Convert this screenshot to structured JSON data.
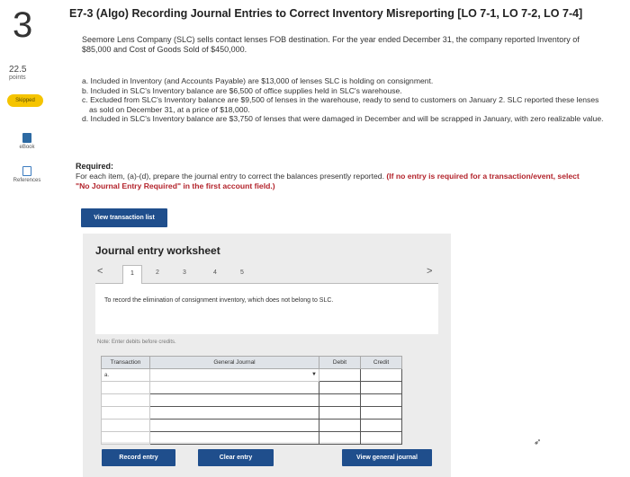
{
  "question": {
    "number": "3",
    "points_value": "22.5",
    "points_label": "points",
    "status_badge": "Skipped"
  },
  "sidebar": {
    "ebook_label": "eBook",
    "references_label": "References"
  },
  "title": "E7-3 (Algo) Recording Journal Entries to Correct Inventory Misreporting [LO 7-1, LO 7-2, LO 7-4]",
  "intro": "Seemore Lens Company (SLC) sells contact lenses FOB destination. For the year ended December 31, the company reported Inventory of $85,000 and Cost of Goods Sold of $450,000.",
  "items": [
    "a. Included in Inventory (and Accounts Payable) are $13,000 of lenses SLC is holding on consignment.",
    "b. Included in SLC's Inventory balance are $6,500 of office supplies held in SLC's warehouse.",
    "c. Excluded from SLC's Inventory balance are $9,500 of lenses in the warehouse, ready to send to customers on January 2. SLC reported these lenses as sold on December 31, at a price of $18,000.",
    "d. Included in SLC's Inventory balance are $3,750 of lenses that were damaged in December and will be scrapped in January, with zero realizable value."
  ],
  "required": {
    "heading": "Required:",
    "body": "For each item, (a)-(d), prepare the journal entry to correct the balances presently reported.",
    "instruction": "(If no entry is required for a transaction/event, select \"No Journal Entry Required\" in the first account field.)"
  },
  "view_transaction_label": "View transaction list",
  "worksheet": {
    "title": "Journal entry worksheet",
    "tabs": [
      "1",
      "2",
      "3",
      "4",
      "5"
    ],
    "active_tab": "1",
    "description": "To record the elimination of consignment inventory, which does not belong to SLC.",
    "note": "Note: Enter debits before credits.",
    "columns": [
      "Transaction",
      "General Journal",
      "Debit",
      "Credit"
    ],
    "rows": [
      {
        "transaction": "a."
      },
      {
        "transaction": ""
      },
      {
        "transaction": ""
      },
      {
        "transaction": ""
      },
      {
        "transaction": ""
      },
      {
        "transaction": ""
      }
    ]
  },
  "buttons": {
    "record": "Record entry",
    "clear": "Clear entry",
    "view_journal": "View general journal"
  },
  "colors": {
    "primary_button": "#1f4e8c",
    "skipped_badge": "#f5c400",
    "instruction_red": "#b3232b"
  }
}
